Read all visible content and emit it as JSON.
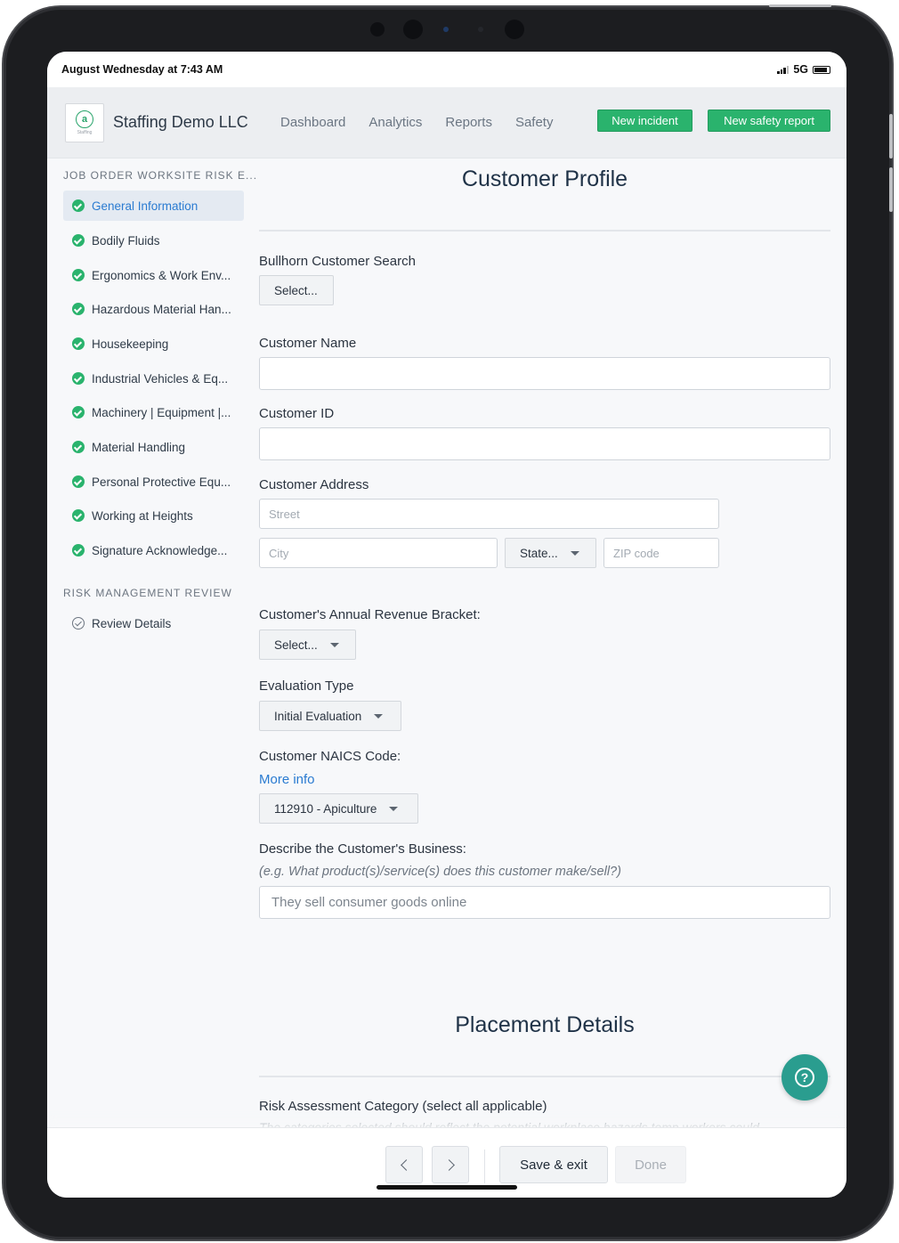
{
  "status": {
    "time": "August Wednesday at 7:43 AM",
    "network": "5G"
  },
  "header": {
    "company": "Staffing Demo LLC",
    "logo_sub": "Staffing",
    "nav": [
      "Dashboard",
      "Analytics",
      "Reports",
      "Safety"
    ],
    "new_incident": "New incident",
    "new_safety_report": "New safety report"
  },
  "sidebar": {
    "section1": "JOB ORDER WORKSITE RISK E...",
    "items": [
      "General Information",
      "Bodily Fluids",
      "Ergonomics & Work Env...",
      "Hazardous Material Han...",
      "Housekeeping",
      "Industrial Vehicles & Eq...",
      "Machinery | Equipment |...",
      "Material Handling",
      "Personal Protective Equ...",
      "Working at Heights",
      "Signature Acknowledge..."
    ],
    "section2": "RISK MANAGEMENT REVIEW",
    "review": "Review Details"
  },
  "form": {
    "title": "Customer Profile",
    "bullhorn_label": "Bullhorn Customer Search",
    "bullhorn_select": "Select...",
    "customer_name_label": "Customer Name",
    "customer_name_value": "",
    "customer_id_label": "Customer ID",
    "customer_id_value": "",
    "address_label": "Customer Address",
    "street_placeholder": "Street",
    "city_placeholder": "City",
    "state_select": "State...",
    "zip_placeholder": "ZIP code",
    "revenue_label": "Customer's Annual Revenue Bracket:",
    "revenue_select": "Select...",
    "eval_label": "Evaluation Type",
    "eval_select": "Initial Evaluation",
    "naics_label": "Customer NAICS Code:",
    "naics_more": "More info",
    "naics_select": "112910 - Apiculture",
    "business_label": "Describe the Customer's Business:",
    "business_helper": "(e.g. What product(s)/service(s) does this customer make/sell?)",
    "business_placeholder": "They sell consumer goods online",
    "placement_title": "Placement Details",
    "risk_label": "Risk Assessment Category (select all applicable)",
    "risk_helper": "The categories selected should reflect the potential workplace hazards temp workers could"
  },
  "bottom": {
    "save_exit": "Save & exit",
    "done": "Done"
  },
  "colors": {
    "accent_green": "#2ab36d",
    "link_blue": "#2a7bd1",
    "help_teal": "#2a9d8f"
  }
}
